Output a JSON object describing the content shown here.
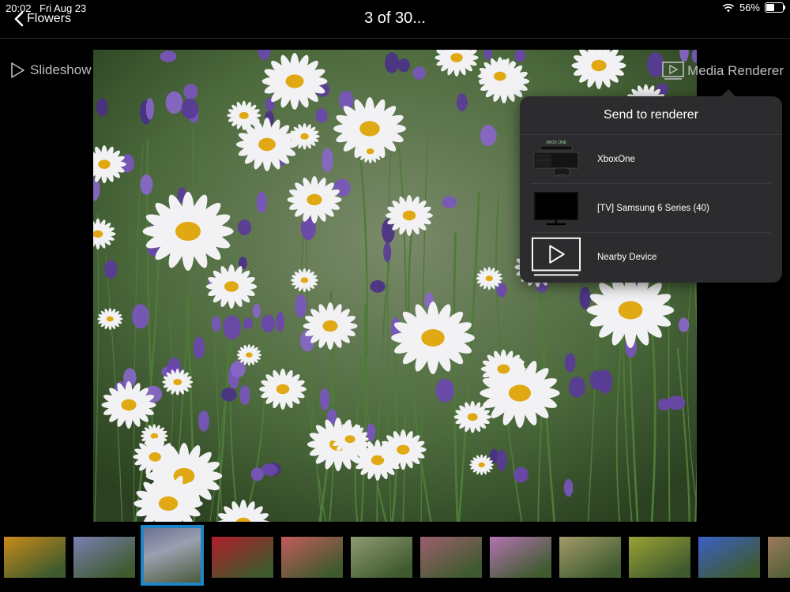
{
  "status": {
    "time": "20:02",
    "date": "Fri Aug 23",
    "battery_percent": "56%",
    "battery_level": 0.56
  },
  "nav": {
    "back_label": "Flowers",
    "title": "3 of 30..."
  },
  "toolbar": {
    "slideshow_label": "Slideshow",
    "media_renderer_label": "Media Renderer"
  },
  "popover": {
    "title": "Send to renderer",
    "items": [
      {
        "label": "XboxOne",
        "icon": "xbox-console-icon",
        "icon_text": "XBOX ONE"
      },
      {
        "label": "[TV] Samsung 6 Series (40)",
        "icon": "tv-icon"
      },
      {
        "label": "Nearby Device",
        "icon": "play-screen-icon"
      }
    ]
  },
  "thumbnails": {
    "selected_index": 2,
    "colors": [
      "#c88a1a",
      "#7a7fb2",
      "#8a8aa3",
      "#b01d2a",
      "#c55b5d",
      "#8f9a72",
      "#9c5f6e",
      "#b374b1",
      "#a49b6a",
      "#9aa234",
      "#3a60c8",
      "#9d7a5c"
    ]
  }
}
